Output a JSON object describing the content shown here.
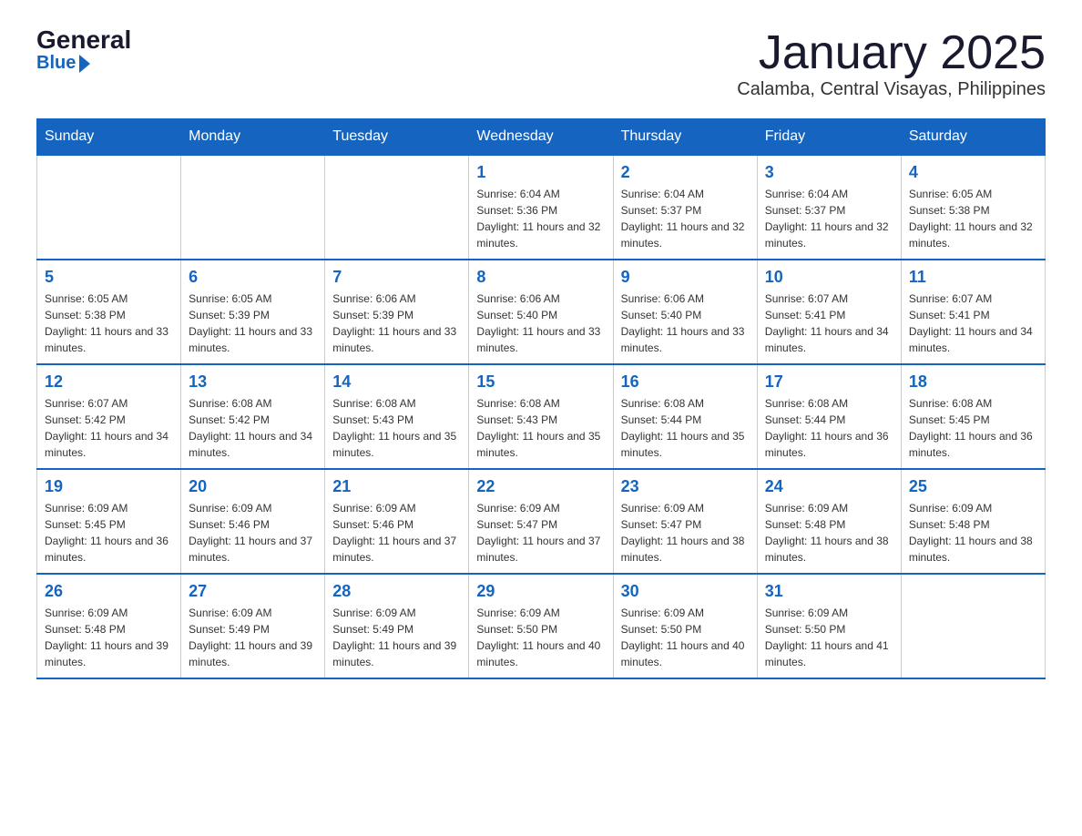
{
  "header": {
    "logo_general": "General",
    "logo_blue": "Blue",
    "month_title": "January 2025",
    "location": "Calamba, Central Visayas, Philippines"
  },
  "weekdays": [
    "Sunday",
    "Monday",
    "Tuesday",
    "Wednesday",
    "Thursday",
    "Friday",
    "Saturday"
  ],
  "weeks": [
    [
      {
        "day": "",
        "info": ""
      },
      {
        "day": "",
        "info": ""
      },
      {
        "day": "",
        "info": ""
      },
      {
        "day": "1",
        "info": "Sunrise: 6:04 AM\nSunset: 5:36 PM\nDaylight: 11 hours and 32 minutes."
      },
      {
        "day": "2",
        "info": "Sunrise: 6:04 AM\nSunset: 5:37 PM\nDaylight: 11 hours and 32 minutes."
      },
      {
        "day": "3",
        "info": "Sunrise: 6:04 AM\nSunset: 5:37 PM\nDaylight: 11 hours and 32 minutes."
      },
      {
        "day": "4",
        "info": "Sunrise: 6:05 AM\nSunset: 5:38 PM\nDaylight: 11 hours and 32 minutes."
      }
    ],
    [
      {
        "day": "5",
        "info": "Sunrise: 6:05 AM\nSunset: 5:38 PM\nDaylight: 11 hours and 33 minutes."
      },
      {
        "day": "6",
        "info": "Sunrise: 6:05 AM\nSunset: 5:39 PM\nDaylight: 11 hours and 33 minutes."
      },
      {
        "day": "7",
        "info": "Sunrise: 6:06 AM\nSunset: 5:39 PM\nDaylight: 11 hours and 33 minutes."
      },
      {
        "day": "8",
        "info": "Sunrise: 6:06 AM\nSunset: 5:40 PM\nDaylight: 11 hours and 33 minutes."
      },
      {
        "day": "9",
        "info": "Sunrise: 6:06 AM\nSunset: 5:40 PM\nDaylight: 11 hours and 33 minutes."
      },
      {
        "day": "10",
        "info": "Sunrise: 6:07 AM\nSunset: 5:41 PM\nDaylight: 11 hours and 34 minutes."
      },
      {
        "day": "11",
        "info": "Sunrise: 6:07 AM\nSunset: 5:41 PM\nDaylight: 11 hours and 34 minutes."
      }
    ],
    [
      {
        "day": "12",
        "info": "Sunrise: 6:07 AM\nSunset: 5:42 PM\nDaylight: 11 hours and 34 minutes."
      },
      {
        "day": "13",
        "info": "Sunrise: 6:08 AM\nSunset: 5:42 PM\nDaylight: 11 hours and 34 minutes."
      },
      {
        "day": "14",
        "info": "Sunrise: 6:08 AM\nSunset: 5:43 PM\nDaylight: 11 hours and 35 minutes."
      },
      {
        "day": "15",
        "info": "Sunrise: 6:08 AM\nSunset: 5:43 PM\nDaylight: 11 hours and 35 minutes."
      },
      {
        "day": "16",
        "info": "Sunrise: 6:08 AM\nSunset: 5:44 PM\nDaylight: 11 hours and 35 minutes."
      },
      {
        "day": "17",
        "info": "Sunrise: 6:08 AM\nSunset: 5:44 PM\nDaylight: 11 hours and 36 minutes."
      },
      {
        "day": "18",
        "info": "Sunrise: 6:08 AM\nSunset: 5:45 PM\nDaylight: 11 hours and 36 minutes."
      }
    ],
    [
      {
        "day": "19",
        "info": "Sunrise: 6:09 AM\nSunset: 5:45 PM\nDaylight: 11 hours and 36 minutes."
      },
      {
        "day": "20",
        "info": "Sunrise: 6:09 AM\nSunset: 5:46 PM\nDaylight: 11 hours and 37 minutes."
      },
      {
        "day": "21",
        "info": "Sunrise: 6:09 AM\nSunset: 5:46 PM\nDaylight: 11 hours and 37 minutes."
      },
      {
        "day": "22",
        "info": "Sunrise: 6:09 AM\nSunset: 5:47 PM\nDaylight: 11 hours and 37 minutes."
      },
      {
        "day": "23",
        "info": "Sunrise: 6:09 AM\nSunset: 5:47 PM\nDaylight: 11 hours and 38 minutes."
      },
      {
        "day": "24",
        "info": "Sunrise: 6:09 AM\nSunset: 5:48 PM\nDaylight: 11 hours and 38 minutes."
      },
      {
        "day": "25",
        "info": "Sunrise: 6:09 AM\nSunset: 5:48 PM\nDaylight: 11 hours and 38 minutes."
      }
    ],
    [
      {
        "day": "26",
        "info": "Sunrise: 6:09 AM\nSunset: 5:48 PM\nDaylight: 11 hours and 39 minutes."
      },
      {
        "day": "27",
        "info": "Sunrise: 6:09 AM\nSunset: 5:49 PM\nDaylight: 11 hours and 39 minutes."
      },
      {
        "day": "28",
        "info": "Sunrise: 6:09 AM\nSunset: 5:49 PM\nDaylight: 11 hours and 39 minutes."
      },
      {
        "day": "29",
        "info": "Sunrise: 6:09 AM\nSunset: 5:50 PM\nDaylight: 11 hours and 40 minutes."
      },
      {
        "day": "30",
        "info": "Sunrise: 6:09 AM\nSunset: 5:50 PM\nDaylight: 11 hours and 40 minutes."
      },
      {
        "day": "31",
        "info": "Sunrise: 6:09 AM\nSunset: 5:50 PM\nDaylight: 11 hours and 41 minutes."
      },
      {
        "day": "",
        "info": ""
      }
    ]
  ]
}
